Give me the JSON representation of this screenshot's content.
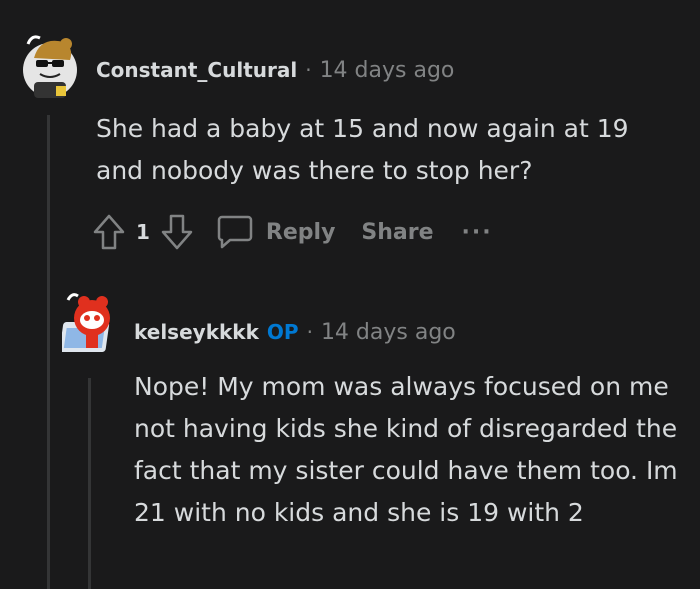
{
  "comments": [
    {
      "username": "Constant_Cultural",
      "separator": "·",
      "timestamp": "14 days ago",
      "body": "She had a baby at 15 and now again at 19 and nobody was there to stop her?",
      "score": "1",
      "actions": {
        "reply": "Reply",
        "share": "Share",
        "more": "···"
      }
    },
    {
      "username": "kelseykkkk",
      "badge": "OP",
      "separator": "·",
      "timestamp": "14 days ago",
      "body": "Nope! My mom was always focused on me not having kids she kind of disregarded the fact that my sister could have them too. Im 21 with no kids and she is 19 with 2"
    }
  ],
  "colors": {
    "background": "#1a1a1b",
    "text": "#d7dadc",
    "muted": "#818384",
    "op_badge": "#0079d3",
    "thread_line": "#343536"
  },
  "icons": [
    "upvote-icon",
    "downvote-icon",
    "comment-icon",
    "more-icon"
  ]
}
